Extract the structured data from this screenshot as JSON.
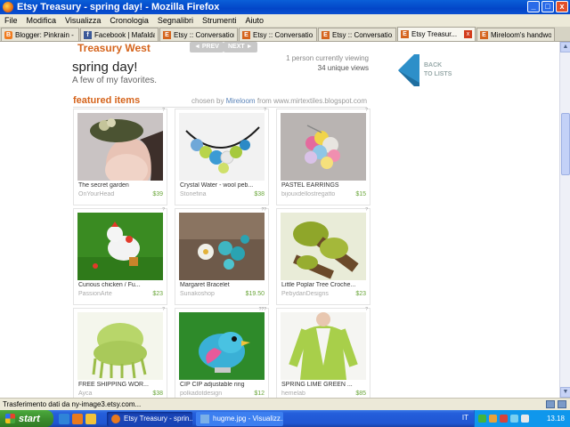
{
  "window": {
    "title": "Etsy Treasury - spring day! - Mozilla Firefox",
    "controls": [
      "_",
      "□",
      "x"
    ]
  },
  "menu": [
    "File",
    "Modifica",
    "Visualizza",
    "Cronologia",
    "Segnalibri",
    "Strumenti",
    "Aiuto"
  ],
  "tabs": [
    {
      "label": "Blogger: Pinkrain - C...",
      "favicon": "B",
      "active": false
    },
    {
      "label": "Facebook | Mafalda ...",
      "favicon": "f",
      "active": false
    },
    {
      "label": "Etsy :: Conversations",
      "favicon": "E",
      "active": false
    },
    {
      "label": "Etsy :: Conversatio...",
      "favicon": "E",
      "active": false
    },
    {
      "label": "Etsy :: Conversatio...",
      "favicon": "E",
      "active": false
    },
    {
      "label": "Etsy Treasur...",
      "favicon": "E",
      "active": true
    },
    {
      "label": "Mireloom's handwov...",
      "favicon": "E",
      "active": false
    }
  ],
  "page": {
    "treasury_title": "Treasury West",
    "prev": "◄ PREV",
    "next": "NEXT ►",
    "title": "spring day!",
    "subtitle": "A few of my favorites.",
    "viewing": "1 person currently viewing",
    "unique_views": "34 unique views",
    "back_line1": "BACK",
    "back_line2": "TO LISTS",
    "featured": "featured items",
    "chosen_by": "chosen by",
    "curator": "Mireloom",
    "from": "from",
    "curator_site": "www.mirtextiles.blogspot.com"
  },
  "items": [
    {
      "name": "The secret garden",
      "shop": "OnYourHead",
      "price": "$39",
      "corner": "?"
    },
    {
      "name": "Crystal Water - wool peb...",
      "shop": "Stonefina",
      "price": "$38",
      "corner": "?"
    },
    {
      "name": "PASTEL EARRINGS",
      "shop": "bijouxdellostregatto",
      "price": "$15",
      "corner": "?"
    },
    {
      "name": "Curious chicken   /    Fu...",
      "shop": "PassionArte",
      "price": "$23",
      "corner": "?"
    },
    {
      "name": "Margaret Bracelet",
      "shop": "Sunakoshop",
      "price": "$19.50",
      "corner": "??"
    },
    {
      "name": "Little Poplar Tree Croche...",
      "shop": "PebydanDesigns",
      "price": "$23",
      "corner": "?"
    },
    {
      "name": "FREE SHIPPING WOR...",
      "shop": "Ayca",
      "price": "$38",
      "corner": "?"
    },
    {
      "name": "CIP CIP adjustable ring",
      "shop": "polkadotdesign",
      "price": "$12",
      "corner": "???"
    },
    {
      "name": "SPRING LIME GREEN ...",
      "shop": "hemelab",
      "price": "$85",
      "corner": "?"
    }
  ],
  "status": "Trasferimento dati da ny-image3.etsy.com...",
  "taskbar": {
    "start": "start",
    "task1": "Etsy Treasury - sprin...",
    "task2": "hugme.jpg - Visualizz...",
    "lang": "IT",
    "clock": "13.18"
  }
}
